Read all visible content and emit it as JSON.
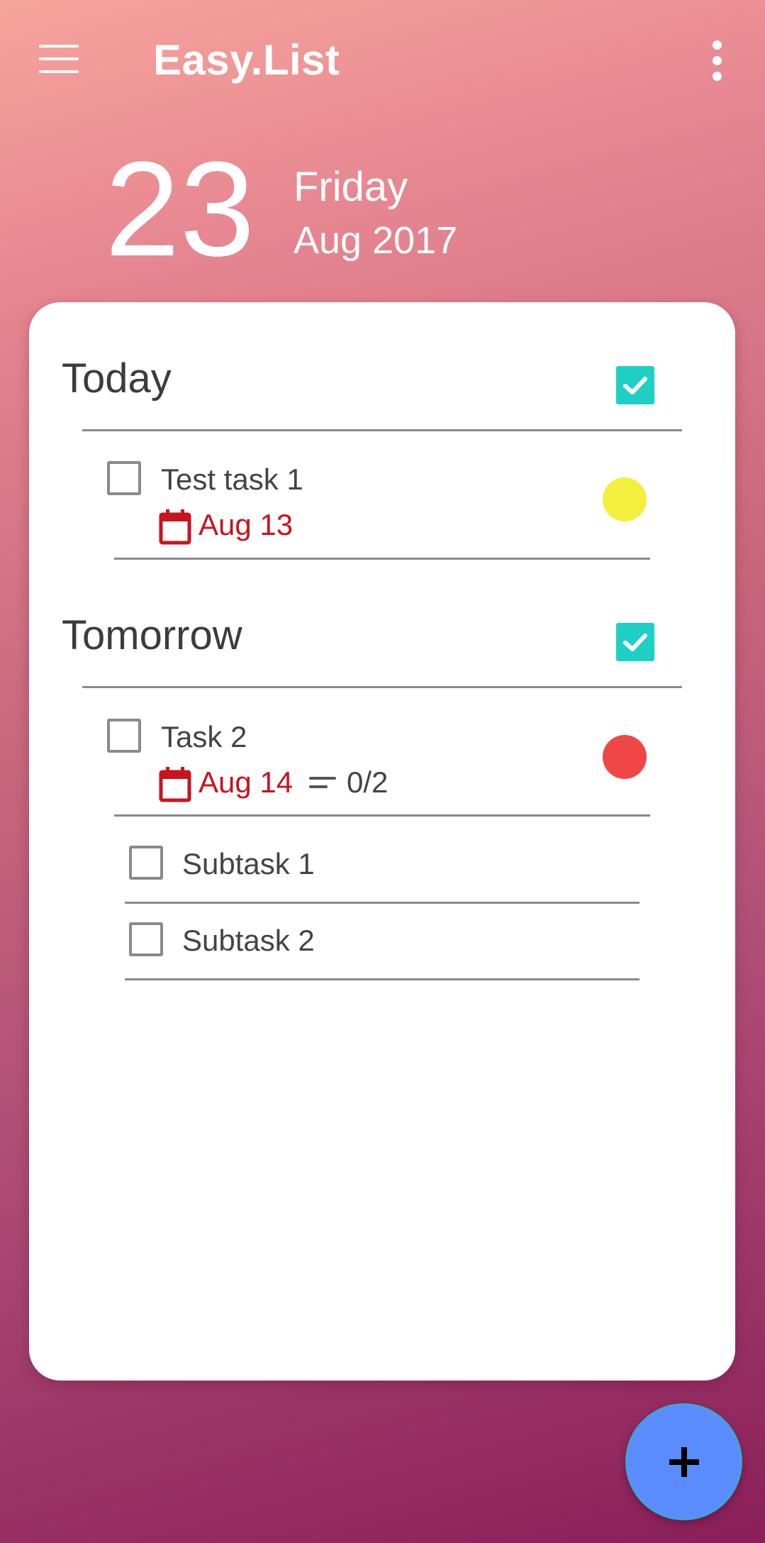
{
  "app": {
    "title": "Easy.List",
    "accent_color": "#1ed0c3",
    "fab_color": "#5b8cff"
  },
  "toolbar": {
    "menu_icon": "hamburger-menu-icon",
    "more_icon": "more-vert-icon"
  },
  "date_header": {
    "day": "23",
    "weekday": "Friday",
    "month_year": "Aug 2017"
  },
  "sections": [
    {
      "title": "Today",
      "checked": true,
      "tasks": [
        {
          "title": "Test task 1",
          "due": "Aug 13",
          "priority_color": "#f3ef3c"
        }
      ]
    },
    {
      "title": "Tomorrow",
      "checked": true,
      "tasks": [
        {
          "title": "Task 2",
          "due": "Aug 14",
          "subtask_count": "0/2",
          "priority_color": "#f04646",
          "subtasks": [
            {
              "title": "Subtask 1"
            },
            {
              "title": "Subtask 2"
            }
          ]
        }
      ]
    }
  ],
  "colors": {
    "due_date": "#c8141e"
  },
  "fab": {
    "icon": "plus-icon"
  }
}
